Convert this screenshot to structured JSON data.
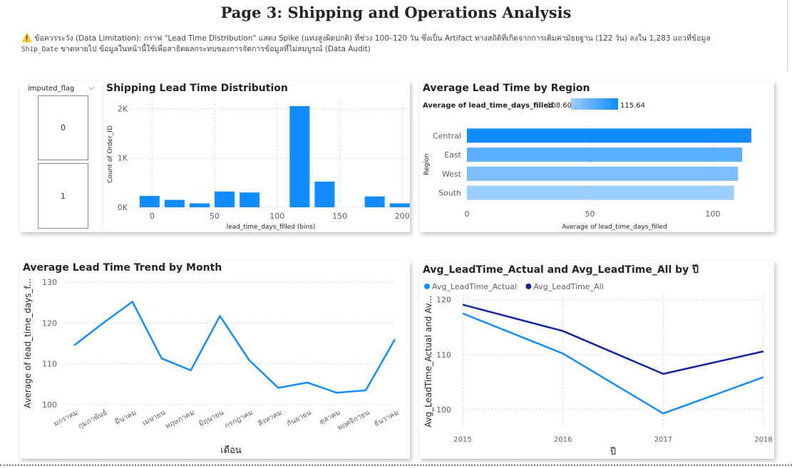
{
  "page": {
    "title": "Page 3: Shipping and Operations Analysis",
    "note_prefix": "ข้อควรระวัง (Data Limitation): กราฟ \"Lead Time Distribution\" แสดง Spike (แท่งสูงผิดปกติ) ที่ช่วง 100–120 วัน ซึ่งเป็น Artifact ทางสถิติที่เกิดจากการเติมค่ามัธยฐาน (122 วัน) ลงใน 1,283 แถวที่ข้อมูล",
    "note_code": "Ship_Date",
    "note_suffix": "ขาดหายไป ข้อมูลในหน้านี้ใช้เพื่อสาธิตผลกระทบของการจัดการข้อมูลที่ไม่สมบูรณ์ (Data Audit)"
  },
  "slicer": {
    "header": "imputed_flag",
    "items": [
      "0",
      "1"
    ]
  },
  "colors": {
    "primary": "#118DFF",
    "dark": "#12239E",
    "grid": "#c8c8c8",
    "region_light": "#9CCDFF"
  },
  "chart_data": [
    {
      "type": "bar",
      "title": "Shipping Lead Time Distribution",
      "xlabel": "lead_time_days_filled (bins)",
      "ylabel": "Count of Order_ID",
      "bin_starts": [
        -10,
        10,
        30,
        50,
        70,
        90,
        110,
        130,
        150,
        170,
        190
      ],
      "bin_width": 16,
      "values": [
        230,
        150,
        80,
        320,
        300,
        0,
        2050,
        520,
        0,
        220,
        80
      ],
      "xticks": [
        0,
        50,
        100,
        150,
        200
      ],
      "yticks": [
        {
          "v": 0,
          "label": "0K"
        },
        {
          "v": 1000,
          "label": "1K"
        },
        {
          "v": 2000,
          "label": "2K"
        }
      ],
      "xlim": [
        -15,
        205
      ],
      "ylim": [
        0,
        2150
      ],
      "grid": true
    },
    {
      "type": "bar",
      "title": "Average Lead Time by Region",
      "orientation": "horizontal",
      "legend_title": "Average of lead_time_days_filled",
      "legend_min": "108.60",
      "legend_max": "115.64",
      "xlabel": "Average of lead_time_days_filled",
      "ylabel": "Region",
      "categories": [
        "Central",
        "East",
        "West",
        "South"
      ],
      "values": [
        115.64,
        111.9,
        110.2,
        108.6
      ],
      "xticks": [
        0,
        50,
        100
      ],
      "xlim": [
        0,
        120
      ],
      "grid": true
    },
    {
      "type": "line",
      "title": "Average Lead Time Trend by Month",
      "xlabel": "เดือน",
      "ylabel": "Average of lead_time_days_f...",
      "categories": [
        "มกราคม",
        "กุมภาพันธ์",
        "มีนาคม",
        "เมษายน",
        "พฤษภาคม",
        "มิถุนายน",
        "กรกฎาคม",
        "สิงหาคม",
        "กันยายน",
        "ตุลาคม",
        "พฤศจิกายน",
        "ธันวาคม"
      ],
      "values": [
        114.5,
        120.0,
        125.2,
        111.3,
        108.4,
        121.7,
        110.9,
        104.1,
        105.4,
        102.9,
        103.5,
        116.0
      ],
      "yticks": [
        100,
        110,
        120,
        130
      ],
      "ylim": [
        100,
        130
      ],
      "grid": true
    },
    {
      "type": "line",
      "title": "Avg_LeadTime_Actual and Avg_LeadTime_All by ปี",
      "xlabel": "ปี",
      "ylabel": "Avg_LeadTime_Actual and Av...",
      "x": [
        "2015",
        "2016",
        "2017",
        "2018"
      ],
      "series": [
        {
          "name": "Avg_LeadTime_Actual",
          "values": [
            117.5,
            110.2,
            99.3,
            105.9
          ]
        },
        {
          "name": "Avg_LeadTime_All",
          "values": [
            119.1,
            114.3,
            106.5,
            110.6
          ]
        }
      ],
      "yticks": [
        100,
        110,
        120
      ],
      "ylim": [
        96.5,
        121
      ],
      "legend": "top-left",
      "grid": true
    }
  ]
}
